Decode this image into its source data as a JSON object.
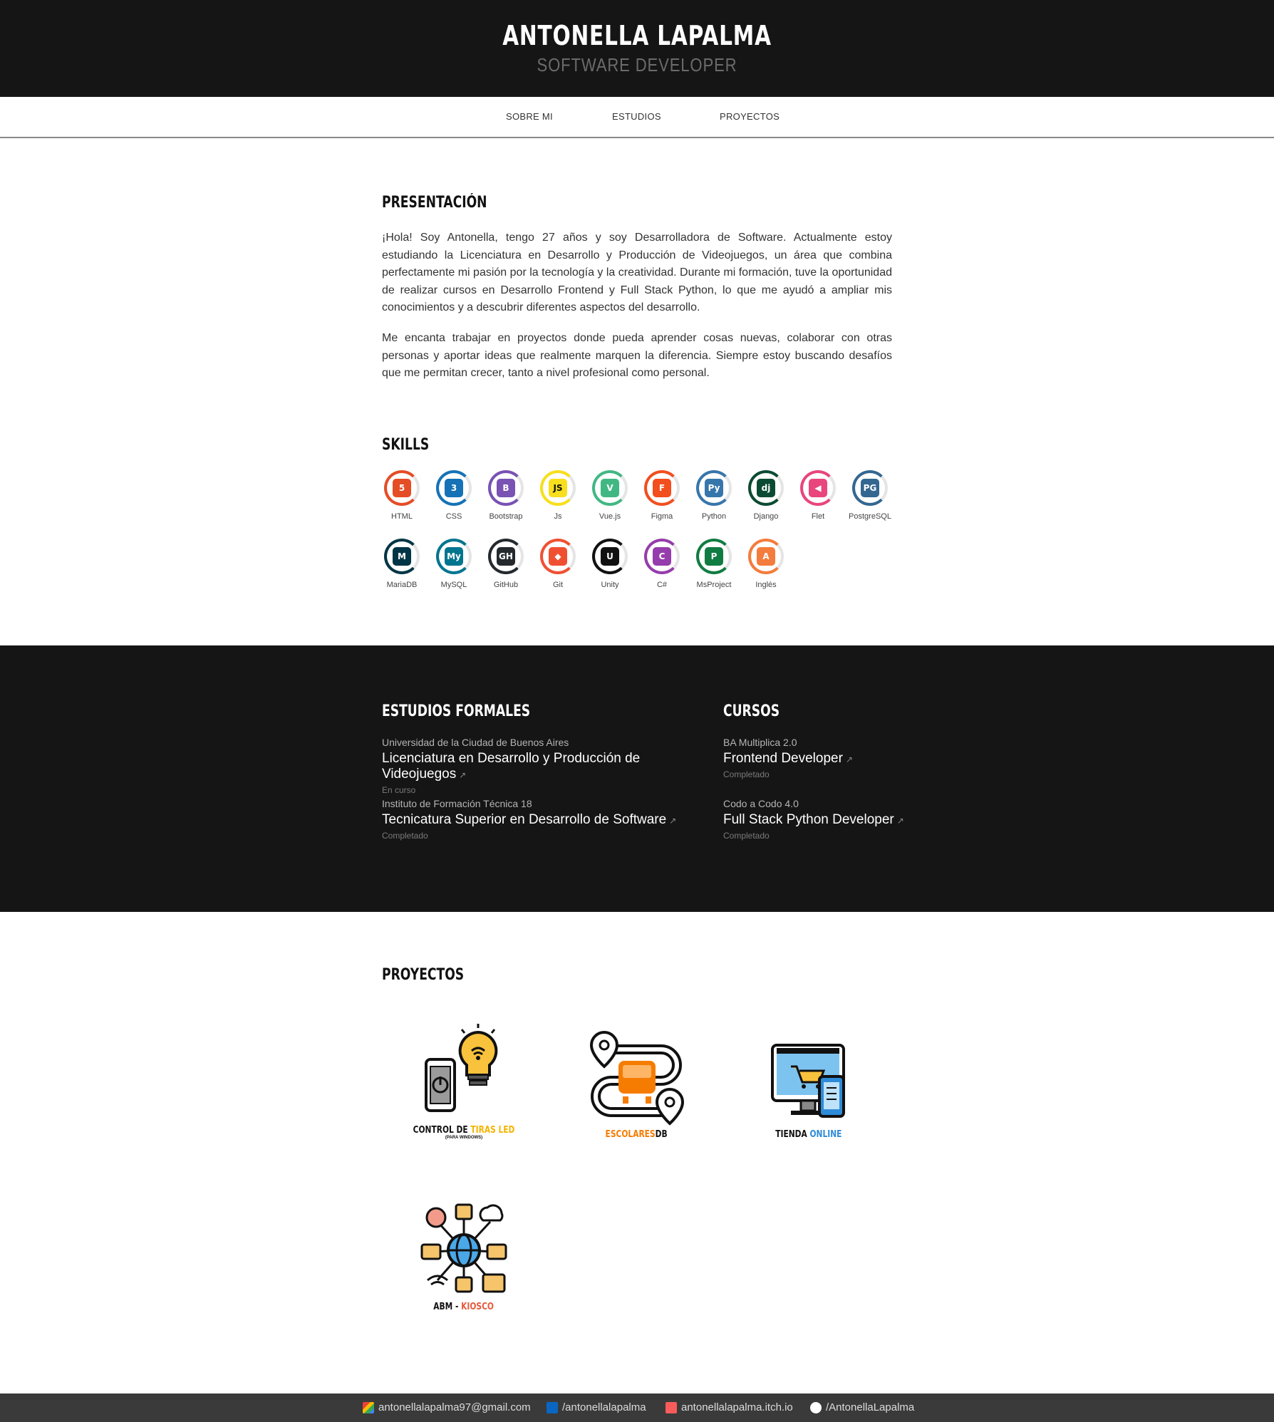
{
  "header": {
    "name": "ANTONELLA LAPALMA",
    "role": "SOFTWARE DEVELOPER"
  },
  "nav": {
    "items": [
      {
        "label": "SOBRE MI"
      },
      {
        "label": "ESTUDIOS"
      },
      {
        "label": "PROYECTOS"
      }
    ]
  },
  "about": {
    "title": "PRESENTACIÓN",
    "paragraphs": [
      "¡Hola! Soy Antonella, tengo 27 años y soy Desarrolladora de Software. Actualmente estoy estudiando la Licenciatura en Desarrollo y Producción de Videojuegos, un área que combina perfectamente mi pasión por la tecnología y la creatividad. Durante mi formación, tuve la oportunidad de realizar cursos en Desarrollo Frontend y Full Stack Python, lo que me ayudó a ampliar mis conocimientos y a descubrir diferentes aspectos del desarrollo.",
      "Me encanta trabajar en proyectos donde pueda aprender cosas nuevas, colaborar con otras personas y aportar ideas que realmente marquen la diferencia. Siempre estoy buscando desafíos que me permitan crecer, tanto a nivel profesional como personal."
    ]
  },
  "skills": {
    "title": "SKILLS",
    "items": [
      {
        "name": "HTML",
        "icon": "html5-icon",
        "color": "#e44d26",
        "glyph": "5"
      },
      {
        "name": "CSS",
        "icon": "css3-icon",
        "color": "#1572b6",
        "glyph": "3"
      },
      {
        "name": "Bootstrap",
        "icon": "bootstrap-icon",
        "color": "#7952b3",
        "glyph": "B"
      },
      {
        "name": "Js",
        "icon": "javascript-icon",
        "color": "#f7df1e",
        "glyph": "JS"
      },
      {
        "name": "Vue.js",
        "icon": "vue-icon",
        "color": "#41b883",
        "glyph": "V"
      },
      {
        "name": "Figma",
        "icon": "figma-icon",
        "color": "#f24e1e",
        "glyph": "F"
      },
      {
        "name": "Python",
        "icon": "python-icon",
        "color": "#3776ab",
        "glyph": "Py"
      },
      {
        "name": "Django",
        "icon": "django-icon",
        "color": "#0c4b33",
        "glyph": "dj"
      },
      {
        "name": "Flet",
        "icon": "flet-icon",
        "color": "#e8467c",
        "glyph": "◀"
      },
      {
        "name": "PostgreSQL",
        "icon": "postgresql-icon",
        "color": "#336791",
        "glyph": "PG"
      },
      {
        "name": "MariaDB",
        "icon": "mariadb-icon",
        "color": "#003545",
        "glyph": "M"
      },
      {
        "name": "MySQL",
        "icon": "mysql-icon",
        "color": "#00758f",
        "glyph": "My"
      },
      {
        "name": "GitHub",
        "icon": "github-icon",
        "color": "#24292e",
        "glyph": "GH"
      },
      {
        "name": "Git",
        "icon": "git-icon",
        "color": "#f05032",
        "glyph": "◆"
      },
      {
        "name": "Unity",
        "icon": "unity-icon",
        "color": "#111111",
        "glyph": "U"
      },
      {
        "name": "C#",
        "icon": "csharp-icon",
        "color": "#953dac",
        "glyph": "C"
      },
      {
        "name": "MsProject",
        "icon": "msproject-icon",
        "color": "#107c41",
        "glyph": "P"
      },
      {
        "name": "Inglés",
        "icon": "translate-icon",
        "color": "#f47c3c",
        "glyph": "A"
      }
    ]
  },
  "studies": {
    "formal_title": "ESTUDIOS FORMALES",
    "courses_title": "CURSOS",
    "formal": [
      {
        "institution": "Universidad de la Ciudad de Buenos Aires",
        "title": "Licenciatura en Desarrollo y Producción de Videojuegos",
        "status": "En curso"
      },
      {
        "institution": "Instituto de Formación Técnica 18",
        "title": "Tecnicatura Superior en Desarrollo de Software",
        "status": "Completado"
      }
    ],
    "courses": [
      {
        "institution": "BA Multiplica 2.0",
        "title": "Frontend Developer",
        "status": "Completado"
      },
      {
        "institution": "Codo a Codo 4.0",
        "title": "Full Stack Python Developer",
        "status": "Completado"
      }
    ]
  },
  "projects": {
    "title": "PROYECTOS",
    "items": [
      {
        "label_a": "CONTROL DE ",
        "label_b": "TIRAS LED",
        "sub": "(PARA WINDOWS)",
        "icon": "led-control-icon"
      },
      {
        "label_a": "ESCOLARES",
        "label_b": "DB",
        "sub": "",
        "icon": "school-bus-route-icon"
      },
      {
        "label_a": "TIENDA ",
        "label_b": "ONLINE",
        "sub": "",
        "icon": "online-store-icon"
      },
      {
        "label_a": "ABM - ",
        "label_b": "KIOSCO",
        "sub": "",
        "icon": "network-database-icon"
      }
    ]
  },
  "footer": {
    "links": [
      {
        "label": "antonellalapalma97@gmail.com",
        "icon": "gmail-icon",
        "color": "#ea4335"
      },
      {
        "label": "/antonellalapalma",
        "icon": "linkedin-icon",
        "color": "#0a66c2"
      },
      {
        "label": "antonellalapalma.itch.io",
        "icon": "itchio-icon",
        "color": "#fa5c5c"
      },
      {
        "label": "/AntonellaLapalma",
        "icon": "github-icon",
        "color": "#ffffff"
      }
    ]
  }
}
